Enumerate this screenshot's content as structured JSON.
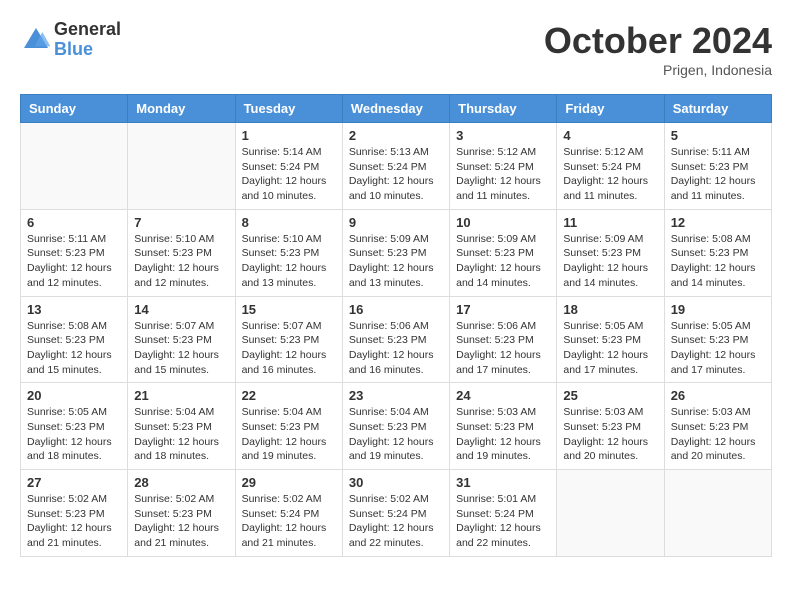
{
  "logo": {
    "general": "General",
    "blue": "Blue"
  },
  "title": "October 2024",
  "subtitle": "Prigen, Indonesia",
  "days_of_week": [
    "Sunday",
    "Monday",
    "Tuesday",
    "Wednesday",
    "Thursday",
    "Friday",
    "Saturday"
  ],
  "weeks": [
    [
      {
        "day": "",
        "info": ""
      },
      {
        "day": "",
        "info": ""
      },
      {
        "day": "1",
        "info": "Sunrise: 5:14 AM\nSunset: 5:24 PM\nDaylight: 12 hours\nand 10 minutes."
      },
      {
        "day": "2",
        "info": "Sunrise: 5:13 AM\nSunset: 5:24 PM\nDaylight: 12 hours\nand 10 minutes."
      },
      {
        "day": "3",
        "info": "Sunrise: 5:12 AM\nSunset: 5:24 PM\nDaylight: 12 hours\nand 11 minutes."
      },
      {
        "day": "4",
        "info": "Sunrise: 5:12 AM\nSunset: 5:24 PM\nDaylight: 12 hours\nand 11 minutes."
      },
      {
        "day": "5",
        "info": "Sunrise: 5:11 AM\nSunset: 5:23 PM\nDaylight: 12 hours\nand 11 minutes."
      }
    ],
    [
      {
        "day": "6",
        "info": "Sunrise: 5:11 AM\nSunset: 5:23 PM\nDaylight: 12 hours\nand 12 minutes."
      },
      {
        "day": "7",
        "info": "Sunrise: 5:10 AM\nSunset: 5:23 PM\nDaylight: 12 hours\nand 12 minutes."
      },
      {
        "day": "8",
        "info": "Sunrise: 5:10 AM\nSunset: 5:23 PM\nDaylight: 12 hours\nand 13 minutes."
      },
      {
        "day": "9",
        "info": "Sunrise: 5:09 AM\nSunset: 5:23 PM\nDaylight: 12 hours\nand 13 minutes."
      },
      {
        "day": "10",
        "info": "Sunrise: 5:09 AM\nSunset: 5:23 PM\nDaylight: 12 hours\nand 14 minutes."
      },
      {
        "day": "11",
        "info": "Sunrise: 5:09 AM\nSunset: 5:23 PM\nDaylight: 12 hours\nand 14 minutes."
      },
      {
        "day": "12",
        "info": "Sunrise: 5:08 AM\nSunset: 5:23 PM\nDaylight: 12 hours\nand 14 minutes."
      }
    ],
    [
      {
        "day": "13",
        "info": "Sunrise: 5:08 AM\nSunset: 5:23 PM\nDaylight: 12 hours\nand 15 minutes."
      },
      {
        "day": "14",
        "info": "Sunrise: 5:07 AM\nSunset: 5:23 PM\nDaylight: 12 hours\nand 15 minutes."
      },
      {
        "day": "15",
        "info": "Sunrise: 5:07 AM\nSunset: 5:23 PM\nDaylight: 12 hours\nand 16 minutes."
      },
      {
        "day": "16",
        "info": "Sunrise: 5:06 AM\nSunset: 5:23 PM\nDaylight: 12 hours\nand 16 minutes."
      },
      {
        "day": "17",
        "info": "Sunrise: 5:06 AM\nSunset: 5:23 PM\nDaylight: 12 hours\nand 17 minutes."
      },
      {
        "day": "18",
        "info": "Sunrise: 5:05 AM\nSunset: 5:23 PM\nDaylight: 12 hours\nand 17 minutes."
      },
      {
        "day": "19",
        "info": "Sunrise: 5:05 AM\nSunset: 5:23 PM\nDaylight: 12 hours\nand 17 minutes."
      }
    ],
    [
      {
        "day": "20",
        "info": "Sunrise: 5:05 AM\nSunset: 5:23 PM\nDaylight: 12 hours\nand 18 minutes."
      },
      {
        "day": "21",
        "info": "Sunrise: 5:04 AM\nSunset: 5:23 PM\nDaylight: 12 hours\nand 18 minutes."
      },
      {
        "day": "22",
        "info": "Sunrise: 5:04 AM\nSunset: 5:23 PM\nDaylight: 12 hours\nand 19 minutes."
      },
      {
        "day": "23",
        "info": "Sunrise: 5:04 AM\nSunset: 5:23 PM\nDaylight: 12 hours\nand 19 minutes."
      },
      {
        "day": "24",
        "info": "Sunrise: 5:03 AM\nSunset: 5:23 PM\nDaylight: 12 hours\nand 19 minutes."
      },
      {
        "day": "25",
        "info": "Sunrise: 5:03 AM\nSunset: 5:23 PM\nDaylight: 12 hours\nand 20 minutes."
      },
      {
        "day": "26",
        "info": "Sunrise: 5:03 AM\nSunset: 5:23 PM\nDaylight: 12 hours\nand 20 minutes."
      }
    ],
    [
      {
        "day": "27",
        "info": "Sunrise: 5:02 AM\nSunset: 5:23 PM\nDaylight: 12 hours\nand 21 minutes."
      },
      {
        "day": "28",
        "info": "Sunrise: 5:02 AM\nSunset: 5:23 PM\nDaylight: 12 hours\nand 21 minutes."
      },
      {
        "day": "29",
        "info": "Sunrise: 5:02 AM\nSunset: 5:24 PM\nDaylight: 12 hours\nand 21 minutes."
      },
      {
        "day": "30",
        "info": "Sunrise: 5:02 AM\nSunset: 5:24 PM\nDaylight: 12 hours\nand 22 minutes."
      },
      {
        "day": "31",
        "info": "Sunrise: 5:01 AM\nSunset: 5:24 PM\nDaylight: 12 hours\nand 22 minutes."
      },
      {
        "day": "",
        "info": ""
      },
      {
        "day": "",
        "info": ""
      }
    ]
  ]
}
